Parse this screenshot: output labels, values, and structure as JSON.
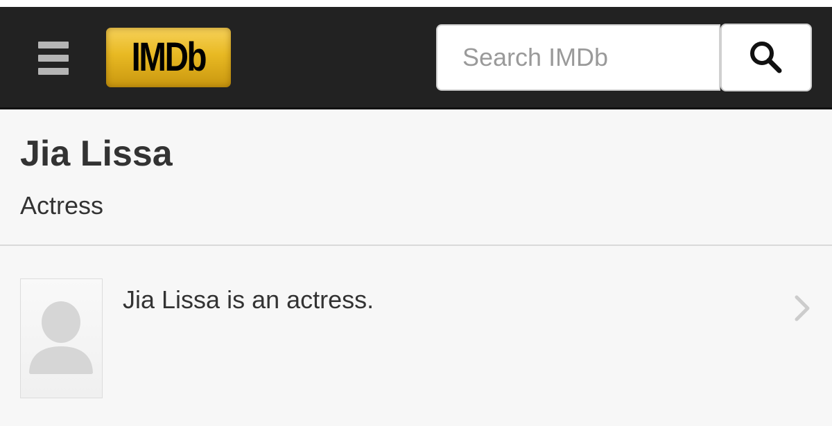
{
  "header": {
    "logo_text": "IMDb",
    "search": {
      "placeholder": "Search IMDb",
      "value": ""
    },
    "colors": {
      "background": "#222222",
      "logo": "#e8b923"
    }
  },
  "person": {
    "name": "Jia Lissa",
    "role": "Actress"
  },
  "bio": {
    "text": "Jia Lissa is an actress."
  },
  "icons": {
    "menu": "hamburger-menu-icon",
    "search": "magnifier-icon",
    "avatar": "person-silhouette-icon",
    "chevron": "chevron-right-icon"
  }
}
